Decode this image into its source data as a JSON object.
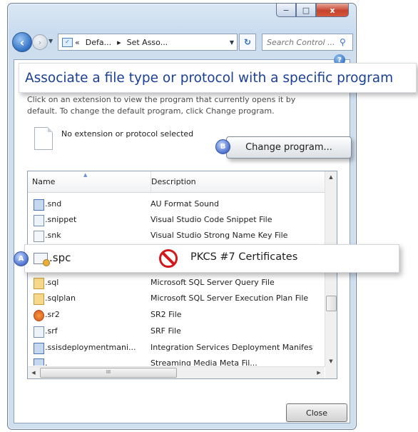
{
  "window": {
    "caption_buttons": {
      "minimize": "−",
      "maximize": "□",
      "close": "x"
    }
  },
  "navbar": {
    "back_icon": "back-arrow-icon",
    "forward_icon": "forward-arrow-icon",
    "address": {
      "prefix": "«",
      "crumbs": [
        "Defa...",
        "Set Asso..."
      ],
      "separator": "▸"
    },
    "refresh_icon": "refresh-icon",
    "search_placeholder": "Search Control ...",
    "search_icon": "magnifier-icon"
  },
  "help_icon": "?",
  "heading": "Associate a file type or protocol with a specific program",
  "description": "Click on an extension to view the program that currently opens it by default. To change the default program, click Change program.",
  "selection": {
    "text": "No extension or protocol selected"
  },
  "change_program": {
    "label": "Change program...",
    "badge": "B"
  },
  "list": {
    "columns": {
      "name": "Name",
      "description": "Description"
    },
    "rows": [
      {
        "ext": ".snd",
        "description": "AU Format Sound",
        "icon": "audio-file-icon"
      },
      {
        "ext": ".snippet",
        "description": "Visual Studio Code Snippet File",
        "icon": "snippet-file-icon"
      },
      {
        "ext": ".snk",
        "description": "Visual Studio Strong Name Key File",
        "icon": "blank-file-icon"
      },
      {
        "ext": ".sql",
        "description": "Microsoft SQL Server Query File",
        "icon": "sql-file-icon"
      },
      {
        "ext": ".sqlplan",
        "description": "Microsoft SQL Server Execution Plan File",
        "icon": "sqlplan-file-icon"
      },
      {
        "ext": ".sr2",
        "description": "SR2 File",
        "icon": "sr2-file-icon"
      },
      {
        "ext": ".srf",
        "description": "SRF File",
        "icon": "srf-file-icon"
      },
      {
        "ext": ".ssisdeploymentmani...",
        "description": "Integration Services Deployment Manifes",
        "icon": "ssis-file-icon"
      },
      {
        "ext": ".",
        "description": "Streaming Media Meta Fil...",
        "icon": "media-file-icon"
      }
    ],
    "highlighted": {
      "ext": ".spc",
      "description": "PKCS #7 Certificates",
      "badge": "A",
      "icon": "certificate-file-icon",
      "status_icon": "no-sign-icon"
    },
    "hscroll_grip": "III"
  },
  "close_button": "Close"
}
